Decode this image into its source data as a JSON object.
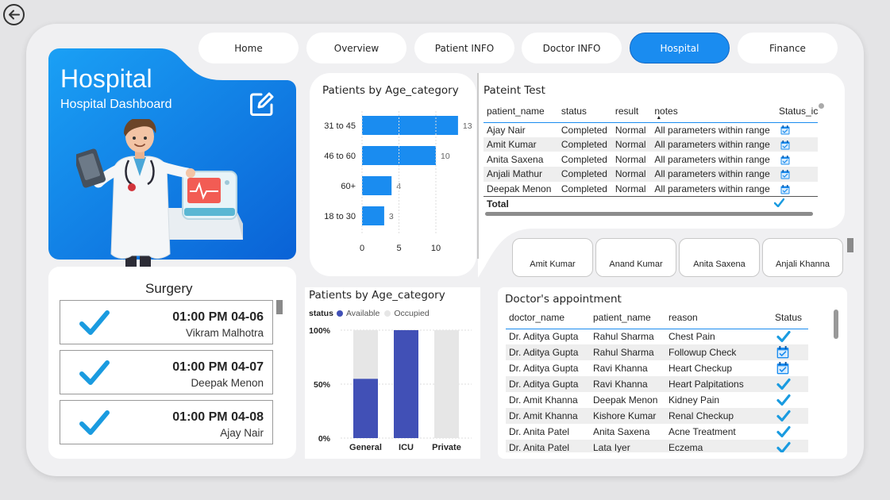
{
  "nav": {
    "tabs": [
      {
        "label": "Home"
      },
      {
        "label": "Overview"
      },
      {
        "label": "Patient INFO"
      },
      {
        "label": "Doctor INFO"
      },
      {
        "label": "Hospital"
      },
      {
        "label": "Finance"
      }
    ],
    "active_tab": "Hospital"
  },
  "hero": {
    "title": "Hospital",
    "subtitle": "Hospital Dashboard"
  },
  "surgery": {
    "title": "Surgery",
    "items": [
      {
        "time": "01:00 PM 04-06",
        "patient": "Vikram Malhotra"
      },
      {
        "time": "01:00 PM 04-07",
        "patient": "Deepak Menon"
      },
      {
        "time": "01:00 PM 04-08",
        "patient": "Ajay Nair"
      }
    ]
  },
  "age_chart": {
    "title": "Patients by Age_category"
  },
  "bed_chart": {
    "title": "Patients by Age_category",
    "legend_label": "status",
    "legend": [
      {
        "name": "Available",
        "color": "#4150b6"
      },
      {
        "name": "Occupied",
        "color": "#e6e6e6"
      }
    ]
  },
  "chart_data": [
    {
      "type": "bar",
      "orientation": "horizontal",
      "title": "Patients by Age_category",
      "categories": [
        "31 to 45",
        "46 to 60",
        "60+",
        "18 to 30"
      ],
      "values": [
        13,
        10,
        4,
        3
      ],
      "xticks": [
        "0",
        "5",
        "10"
      ],
      "xlim": [
        0,
        13
      ],
      "color": "#1a8cf0"
    },
    {
      "type": "bar",
      "stacked": true,
      "title": "Patients by Age_category",
      "categories": [
        "General",
        "ICU",
        "Private"
      ],
      "series": [
        {
          "name": "Available",
          "values": [
            0.55,
            1.0,
            0.0
          ],
          "color": "#4150b6"
        },
        {
          "name": "Occupied",
          "values": [
            0.45,
            0.0,
            1.0
          ],
          "color": "#e6e6e6"
        }
      ],
      "yticks": [
        "100%",
        "50%",
        "0%"
      ],
      "ylim": [
        0,
        1
      ]
    }
  ],
  "patient_test": {
    "title": "Pateint Test",
    "columns": [
      "patient_name",
      "status",
      "result",
      "notes",
      "Status_icon"
    ],
    "rows": [
      {
        "patient_name": "Ajay Nair",
        "status": "Completed",
        "result": "Normal",
        "notes": "All parameters within range",
        "icon": "calendar-icon"
      },
      {
        "patient_name": "Amit Kumar",
        "status": "Completed",
        "result": "Normal",
        "notes": "All parameters within range",
        "icon": "calendar-icon"
      },
      {
        "patient_name": "Anita Saxena",
        "status": "Completed",
        "result": "Normal",
        "notes": "All parameters within range",
        "icon": "calendar-icon"
      },
      {
        "patient_name": "Anjali Mathur",
        "status": "Completed",
        "result": "Normal",
        "notes": "All parameters within range",
        "icon": "calendar-icon"
      },
      {
        "patient_name": "Deepak Menon",
        "status": "Completed",
        "result": "Normal",
        "notes": "All parameters within range",
        "icon": "calendar-icon"
      }
    ],
    "total_label": "Total"
  },
  "doctor_cards": [
    {
      "name": "Amit Kumar"
    },
    {
      "name": "Anand Kumar"
    },
    {
      "name": "Anita Saxena"
    },
    {
      "name": "Anjali Khanna"
    }
  ],
  "appointments": {
    "title": "Doctor's appointment",
    "columns": [
      "doctor_name",
      "patient_name",
      "reason",
      "Status"
    ],
    "rows": [
      {
        "doctor": "Dr. Aditya Gupta",
        "patient": "Rahul Sharma",
        "reason": "Chest Pain",
        "icon": "check"
      },
      {
        "doctor": "Dr. Aditya Gupta",
        "patient": "Rahul Sharma",
        "reason": "Followup Check",
        "icon": "calendar"
      },
      {
        "doctor": "Dr. Aditya Gupta",
        "patient": "Ravi Khanna",
        "reason": "Heart Checkup",
        "icon": "calendar"
      },
      {
        "doctor": "Dr. Aditya Gupta",
        "patient": "Ravi Khanna",
        "reason": "Heart Palpitations",
        "icon": "check"
      },
      {
        "doctor": "Dr. Amit Khanna",
        "patient": "Deepak Menon",
        "reason": "Kidney Pain",
        "icon": "check"
      },
      {
        "doctor": "Dr. Amit Khanna",
        "patient": "Kishore Kumar",
        "reason": "Renal Checkup",
        "icon": "check"
      },
      {
        "doctor": "Dr. Anita Patel",
        "patient": "Anita Saxena",
        "reason": "Acne Treatment",
        "icon": "check"
      },
      {
        "doctor": "Dr. Anita Patel",
        "patient": "Lata Iyer",
        "reason": "Eczema",
        "icon": "check"
      }
    ]
  },
  "colors": {
    "accent": "#1a8cf0",
    "available": "#4150b6",
    "occupied": "#e6e6e6",
    "check": "#1a9be0"
  }
}
